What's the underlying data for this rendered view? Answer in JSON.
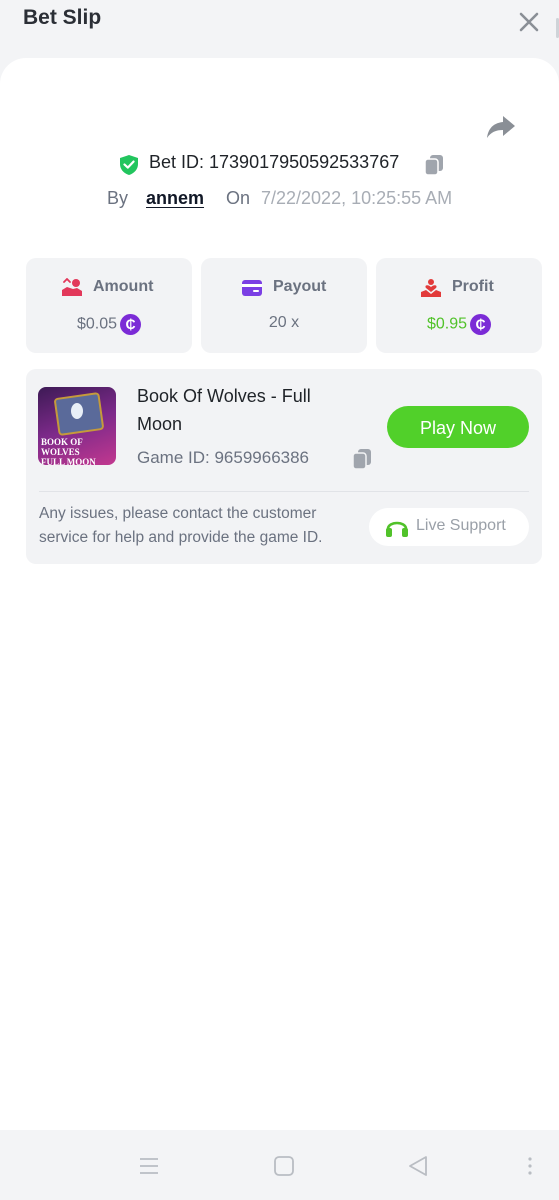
{
  "header": {
    "title": "Bet Slip"
  },
  "bet": {
    "id_text": "Bet ID: 1739017950592533767",
    "by_label": "By",
    "user": "annem",
    "on_label": "On",
    "date": "7/22/2022, 10:25:55 AM"
  },
  "stats": [
    {
      "label": "Amount",
      "value": "$0.05",
      "has_coin": true,
      "icon": "hand-coins-icon",
      "color": "#e2385a"
    },
    {
      "label": "Payout",
      "value": "20 x",
      "has_coin": false,
      "icon": "card-icon",
      "color": "#7b3fe4"
    },
    {
      "label": "Profit",
      "value": "$0.95",
      "has_coin": true,
      "icon": "hand-heart-icon",
      "color": "#e23a3a",
      "value_color": "#51c22a"
    }
  ],
  "coin_symbol": "₵",
  "game": {
    "thumb_text_line1": "BOOK OF WOLVES",
    "thumb_text_line2": "FULL MOON",
    "name": "Book Of Wolves - Full Moon",
    "id_text": "Game ID: 9659966386",
    "play_label": "Play Now",
    "issues_text": "Any issues, please contact the customer service for help and provide the game ID.",
    "support_label": "Live Support"
  },
  "colors": {
    "accent_green": "#51d02a",
    "coin_purple": "#7b2bd6",
    "shield_green": "#22c55e"
  }
}
